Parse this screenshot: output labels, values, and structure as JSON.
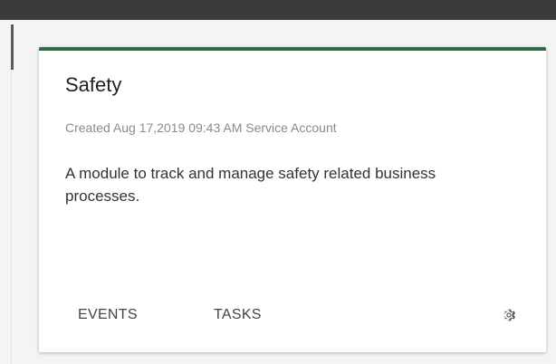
{
  "card": {
    "title": "Safety",
    "meta": "Created Aug 17,2019 09:43 AM Service Account",
    "description": "A module to track and manage safety related business processes.",
    "actions": {
      "events_label": "EVENTS",
      "tasks_label": "TASKS",
      "settings_icon": "gear-icon"
    },
    "accent_color": "#2f6b45"
  }
}
